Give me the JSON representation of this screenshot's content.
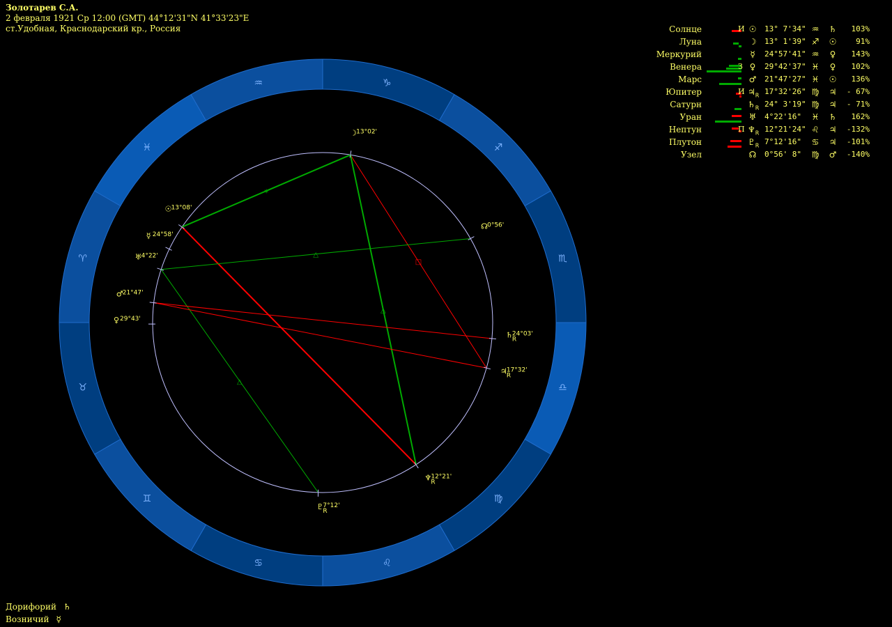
{
  "header": {
    "name": "Золотарев С.А.",
    "line2": "2 февраля 1921  Ср  12:00 (GMT) 44°12'31\"N  41°33'23\"E",
    "line3": "ст.Удобная, Краснодарский кр., Россия"
  },
  "colors": {
    "bg": "#000000",
    "text": "#ffff66",
    "ring_dark": "#003e80",
    "ring_light": "#0a5bb5",
    "circle": "#c0c0ff",
    "line_red": "#ff0000",
    "line_green": "#00aa00"
  },
  "zodiac_ring": {
    "signs": [
      "♑",
      "♐",
      "♏",
      "♎",
      "♍",
      "♌",
      "♋",
      "♊",
      "♉",
      "♈",
      "♓",
      "♒"
    ]
  },
  "planets": [
    {
      "name": "Солнце",
      "bars": [
        [
          "red",
          0,
          14,
          1
        ]
      ],
      "ruler": "И",
      "glyph": "☉",
      "retro": "",
      "deg": "13° 7'34\"",
      "sign": "♒",
      "dispos": "♄",
      "pct": "103%"
    },
    {
      "name": "Луна",
      "bars": [
        [
          "green",
          4,
          8,
          1
        ],
        [
          "green",
          0,
          4,
          2
        ]
      ],
      "ruler": "",
      "glyph": "☽",
      "retro": "",
      "deg": "13° 1'39\"",
      "sign": "♐",
      "dispos": "☉",
      "pct": "91%"
    },
    {
      "name": "Меркурий",
      "bars": [
        [
          "green",
          0,
          5,
          2
        ]
      ],
      "ruler": "",
      "glyph": "☿",
      "retro": "",
      "deg": "24°57'41\"",
      "sign": "♒",
      "dispos": "♀",
      "pct": "143%"
    },
    {
      "name": "Венера",
      "bars": [
        [
          "green",
          0,
          18,
          0
        ],
        [
          "green",
          0,
          22,
          1
        ],
        [
          "green",
          0,
          50,
          2
        ]
      ],
      "ruler": "З",
      "glyph": "♀",
      "retro": "",
      "deg": "29°42'37\"",
      "sign": "♓",
      "dispos": "♀",
      "pct": "102%"
    },
    {
      "name": "Марс",
      "bars": [
        [
          "green",
          0,
          5,
          0
        ],
        [
          "green",
          0,
          32,
          2
        ]
      ],
      "ruler": "",
      "glyph": "♂",
      "retro": "",
      "deg": "21°47'27\"",
      "sign": "♓",
      "dispos": "☉",
      "pct": "136%"
    },
    {
      "name": "Юпитер",
      "bars": [
        [
          "red",
          0,
          8,
          1
        ],
        [
          "red",
          0,
          3,
          2
        ]
      ],
      "ruler": "И",
      "glyph": "♃",
      "retro": "R",
      "deg": "17°32'26\"",
      "sign": "♍",
      "dispos": "♃",
      "pct": "- 67%"
    },
    {
      "name": "Сатурн",
      "bars": [
        [
          "green",
          0,
          10,
          2
        ]
      ],
      "ruler": "",
      "glyph": "♄",
      "retro": "R",
      "deg": "24° 3'19\"",
      "sign": "♍",
      "dispos": "♃",
      "pct": "- 71%"
    },
    {
      "name": "Уран",
      "bars": [
        [
          "red",
          0,
          14,
          0
        ],
        [
          "green",
          0,
          38,
          2
        ]
      ],
      "ruler": "",
      "glyph": "♅",
      "retro": "",
      "deg": "4°22'16\"",
      "sign": "♓",
      "dispos": "♄",
      "pct": "162%"
    },
    {
      "name": "Нептун",
      "bars": [
        [
          "red",
          4,
          10,
          0
        ],
        [
          "red",
          0,
          4,
          1
        ]
      ],
      "ruler": "П",
      "glyph": "♆",
      "retro": "R",
      "deg": "12°21'24\"",
      "sign": "♌",
      "dispos": "♃",
      "pct": "-132%"
    },
    {
      "name": "Плутон",
      "bars": [
        [
          "red",
          0,
          16,
          0
        ],
        [
          "red",
          0,
          20,
          2
        ]
      ],
      "ruler": "",
      "glyph": "♇",
      "retro": "R",
      "deg": "7°12'16\"",
      "sign": "♋",
      "dispos": "♃",
      "pct": "-101%"
    },
    {
      "name": "Узел",
      "bars": [],
      "ruler": "",
      "glyph": "☊",
      "retro": "",
      "deg": "0°56' 8\"",
      "sign": "♍",
      "dispos": "♂",
      "pct": "-140%"
    }
  ],
  "chart_points": [
    {
      "glyph": "☉",
      "retro": "",
      "label": "13°08'"
    },
    {
      "glyph": "☽",
      "retro": "",
      "label": "13°02'"
    },
    {
      "glyph": "☿",
      "retro": "",
      "label": "24°58'"
    },
    {
      "glyph": "♅",
      "retro": "",
      "label": "4°22'"
    },
    {
      "glyph": "♂",
      "retro": "",
      "label": "21°47'"
    },
    {
      "glyph": "♀",
      "retro": "",
      "label": "29°43'"
    },
    {
      "glyph": "☊",
      "retro": "",
      "label": "0°56'"
    },
    {
      "glyph": "♄",
      "retro": "R",
      "label": "24°03'"
    },
    {
      "glyph": "♃",
      "retro": "R",
      "label": "17°32'"
    },
    {
      "glyph": "♆",
      "retro": "R",
      "label": "12°21'"
    },
    {
      "glyph": "♇",
      "retro": "R",
      "label": "7°12'"
    }
  ],
  "aspects": [
    {
      "from": "☉",
      "to": "♆",
      "color": "red",
      "symbol": ""
    },
    {
      "from": "☉",
      "to": "☽",
      "color": "green",
      "symbol": "✶"
    },
    {
      "from": "☽",
      "to": "♃",
      "color": "red",
      "symbol": "□"
    },
    {
      "from": "☽",
      "to": "♆",
      "color": "green",
      "symbol": "△"
    },
    {
      "from": "♅",
      "to": "☊",
      "color": "green",
      "symbol": "△"
    },
    {
      "from": "♅",
      "to": "♇",
      "color": "green",
      "symbol": "△"
    },
    {
      "from": "♂",
      "to": "♄",
      "color": "red",
      "symbol": ""
    },
    {
      "from": "♂",
      "to": "♃",
      "color": "red",
      "symbol": ""
    }
  ],
  "footer": {
    "doryphory_label": "Дорифорий",
    "doryphory_glyph": "♄",
    "charioteer_label": "Возничий",
    "charioteer_glyph": "☿"
  }
}
